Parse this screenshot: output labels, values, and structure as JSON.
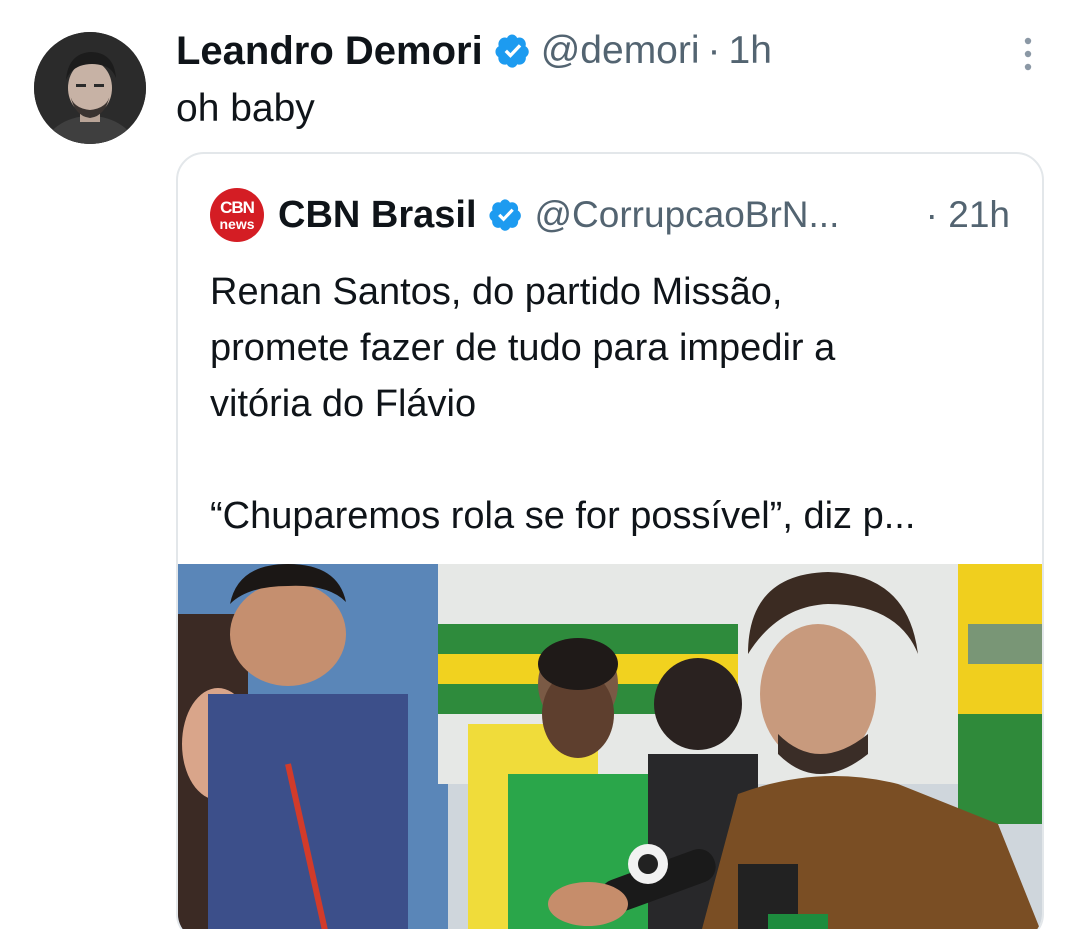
{
  "tweet": {
    "author_name": "Leandro Demori",
    "verified_icon": "verified-badge-icon",
    "handle": "@demori",
    "separator": "·",
    "time": "1h",
    "text": "oh baby",
    "more_icon": "more-vertical-icon"
  },
  "quote": {
    "logo_line1": "CBN",
    "logo_line2": "news",
    "author_name": "CBN Brasil",
    "handle": "@CorrupcaoBrN...",
    "separator": "·",
    "time": "21h",
    "text_lines": [
      "Renan Santos, do partido Missão,",
      "promete fazer de tudo para impedir a",
      "vitória do Flávio"
    ],
    "text_line2": "“Chuparemos rola se for possível”, diz p..."
  },
  "colors": {
    "accent_verified": "#1d9bf0",
    "secondary_text": "#536471",
    "cbn_red": "#d41d24"
  }
}
